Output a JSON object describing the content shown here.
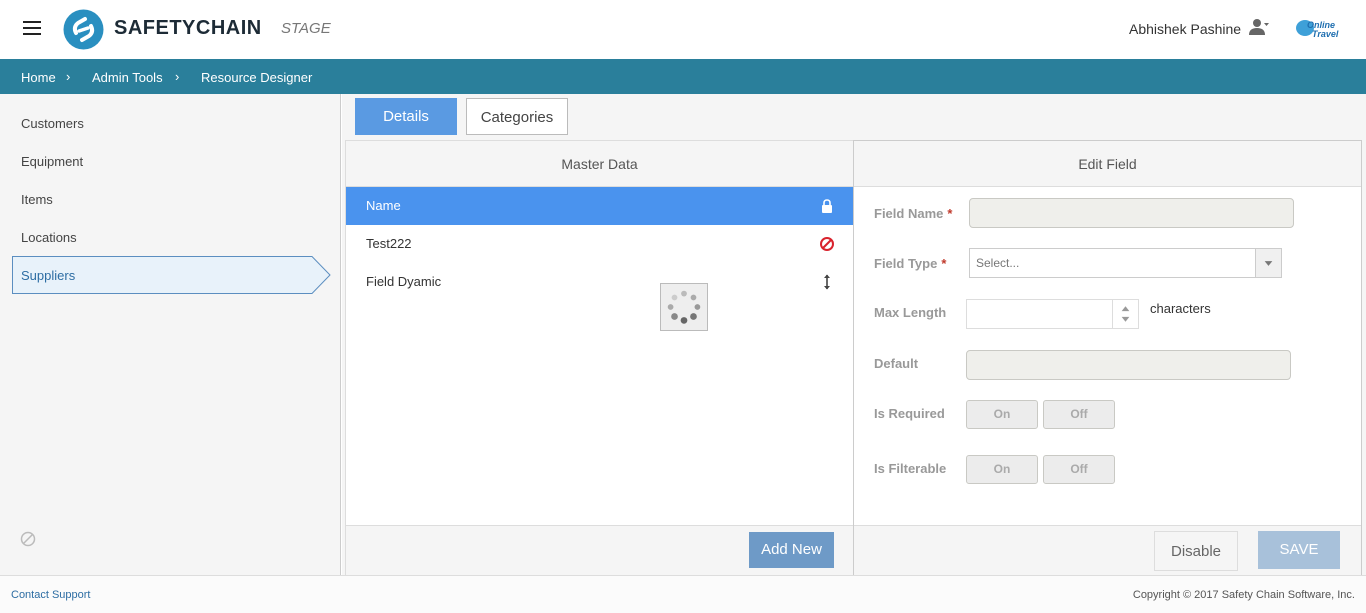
{
  "header": {
    "brand": "SAFETYCHAIN",
    "environment": "STAGE",
    "user_name": "Abhishek Pashine",
    "org_logo_text": "Online Travel"
  },
  "breadcrumb": [
    "Home",
    "Admin Tools",
    "Resource Designer"
  ],
  "sidebar": {
    "items": [
      "Customers",
      "Equipment",
      "Items",
      "Locations",
      "Suppliers"
    ],
    "active": "Suppliers"
  },
  "tabs": {
    "details": "Details",
    "categories": "Categories",
    "active": "Details"
  },
  "master_data": {
    "title": "Master Data",
    "rows": [
      {
        "label": "Name",
        "icon": "lock-icon",
        "selected": true
      },
      {
        "label": "Test222",
        "icon": "no-entry-icon",
        "selected": false
      },
      {
        "label": "Field Dyamic",
        "icon": "reorder-icon",
        "selected": false
      }
    ],
    "add_new_label": "Add New"
  },
  "edit_field": {
    "title": "Edit Field",
    "field_name_label": "Field Name",
    "field_name_value": "",
    "field_type_label": "Field Type",
    "field_type_placeholder": "Select...",
    "max_length_label": "Max Length",
    "max_length_value": "",
    "max_length_unit": "characters",
    "default_label": "Default",
    "default_value": "",
    "is_required_label": "Is Required",
    "is_filterable_label": "Is Filterable",
    "on_label": "On",
    "off_label": "Off",
    "disable_label": "Disable",
    "save_label": "SAVE"
  },
  "footer": {
    "contact_support": "Contact Support",
    "copyright": "Copyright © 2017 Safety Chain Software, Inc."
  },
  "colors": {
    "brand_teal": "#2a7f9b",
    "tab_active": "#5a9ae2",
    "row_selected": "#4a93ee",
    "required_star": "#c0392b"
  }
}
